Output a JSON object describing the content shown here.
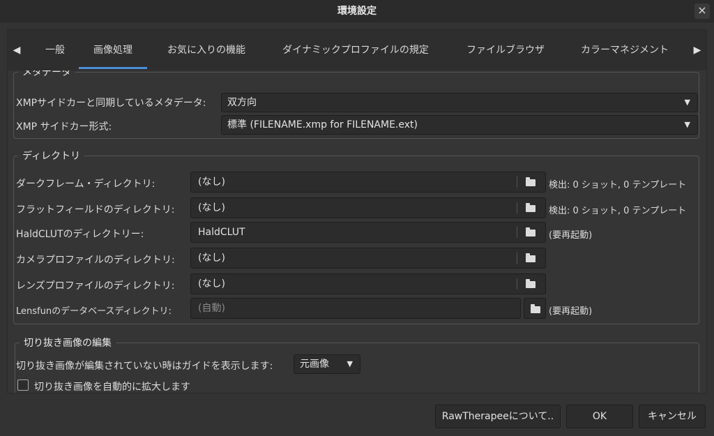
{
  "window": {
    "title": "環境設定",
    "close_label": "×"
  },
  "tabs": [
    {
      "label": "一般"
    },
    {
      "label": "画像処理"
    },
    {
      "label": "お気に入りの機能"
    },
    {
      "label": "ダイナミックプロファイルの規定"
    },
    {
      "label": "ファイルブラウザ"
    },
    {
      "label": "カラーマネジメント"
    }
  ],
  "metadata": {
    "legend": "メタデータ",
    "sync_label": "XMPサイドカーと同期しているメタデータ:",
    "sync_value": "双方向",
    "format_label": "XMP サイドカー形式:",
    "format_value": "標準 (FILENAME.xmp for FILENAME.ext)"
  },
  "directories": {
    "legend": "ディレクトリ",
    "rows": [
      {
        "label": "ダークフレーム・ディレクトリ:",
        "value": "(なし)",
        "note": "検出: 0 ショット, 0 テンプレート"
      },
      {
        "label": "フラットフィールドのディレクトリ:",
        "value": "(なし)",
        "note": "検出: 0 ショット, 0 テンプレート"
      },
      {
        "label": "HaldCLUTのディレクトリー:",
        "value": "HaldCLUT",
        "note": "(要再起動)"
      },
      {
        "label": "カメラプロファイルのディレクトリ:",
        "value": "(なし)",
        "note": ""
      },
      {
        "label": "レンズプロファイルのディレクトリ:",
        "value": "(なし)",
        "note": ""
      },
      {
        "label": "Lensfunのデータベースディレクトリ:",
        "value": "(自動)",
        "note": "(要再起動)"
      }
    ]
  },
  "crop": {
    "legend": "切り抜き画像の編集",
    "guide_label": "切り抜き画像が編集されていない時はガイドを表示します:",
    "guide_value": "元画像",
    "autofit_label": "切り抜き画像を自動的に拡大します"
  },
  "buttons": {
    "about": "RawTherapeeについて..",
    "ok": "OK",
    "cancel": "キャンセル"
  }
}
